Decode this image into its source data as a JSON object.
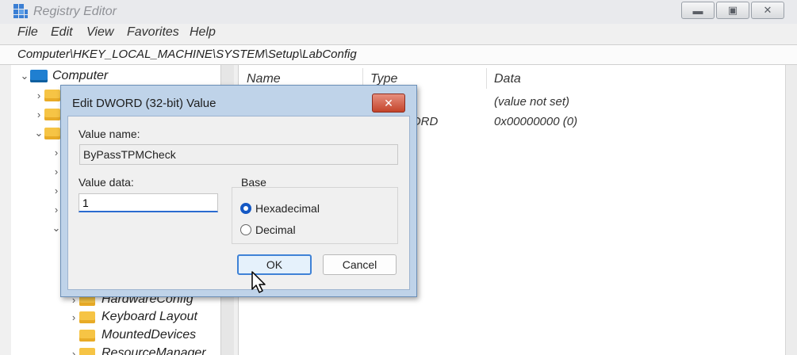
{
  "window": {
    "title": "Registry Editor",
    "controls": [
      "▬",
      "▣",
      "✕"
    ]
  },
  "menu": [
    "File",
    "Edit",
    "View",
    "Favorites",
    "Help"
  ],
  "address": "Computer\\HKEY_LOCAL_MACHINE\\SYSTEM\\Setup\\LabConfig",
  "tree": {
    "root": "Computer",
    "items": [
      "HardwareConfig",
      "Keyboard Layout",
      "MountedDevices",
      "ResourceManager"
    ]
  },
  "list": {
    "columns": [
      "Name",
      "Type",
      "Data"
    ],
    "rows": [
      {
        "type": "",
        "data": "(value not set)"
      },
      {
        "type": "ORD",
        "data": "0x00000000 (0)"
      }
    ]
  },
  "dialog": {
    "title": "Edit DWORD (32-bit) Value",
    "close": "✕",
    "value_name_label": "Value name:",
    "value_name": "ByPassTPMCheck",
    "value_data_label": "Value data:",
    "value_data": "1",
    "base_label": "Base",
    "hex_label": "Hexadecimal",
    "dec_label": "Decimal",
    "ok": "OK",
    "cancel": "Cancel"
  },
  "colors": {
    "dialog_frame": "#bfd3e9",
    "close_button": "#c4442b",
    "accent": "#1458c4"
  }
}
